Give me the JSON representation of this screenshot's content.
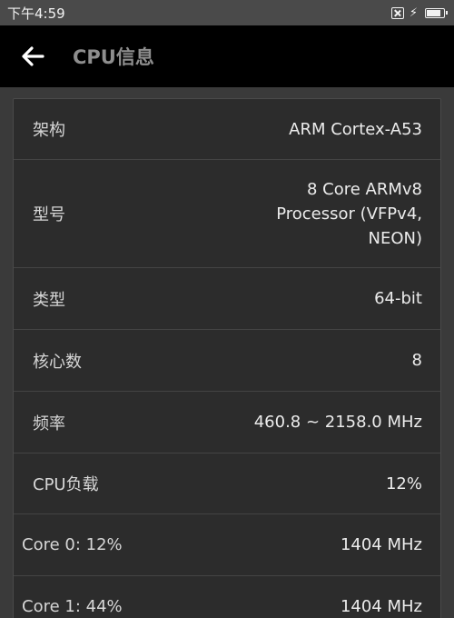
{
  "status_bar": {
    "time": "下午4:59",
    "icons": [
      "sim-card-icon",
      "charging-icon",
      "battery-icon"
    ]
  },
  "app_bar": {
    "back_icon": "arrow-left-icon",
    "title": "CPU信息"
  },
  "cpu_info": [
    {
      "label": "架构",
      "value": "ARM Cortex-A53"
    },
    {
      "label": "型号",
      "value_lines": [
        "8 Core ARMv8",
        "Processor (VFPv4,",
        "NEON)"
      ]
    },
    {
      "label": "类型",
      "value": "64-bit"
    },
    {
      "label": "核心数",
      "value": "8"
    },
    {
      "label": "频率",
      "value": "460.8 ~ 2158.0 MHz"
    },
    {
      "label": "CPU负载",
      "value": "12%"
    },
    {
      "label": "Core 0: 12%",
      "value": "1404 MHz"
    },
    {
      "label": "Core 1: 44%",
      "value": "1404 MHz"
    }
  ],
  "colors": {
    "background": "#3a3a3a",
    "app_bar": "#000000",
    "card": "#2c2c2c",
    "divider": "#444444",
    "title_text": "#8e8e8e"
  }
}
